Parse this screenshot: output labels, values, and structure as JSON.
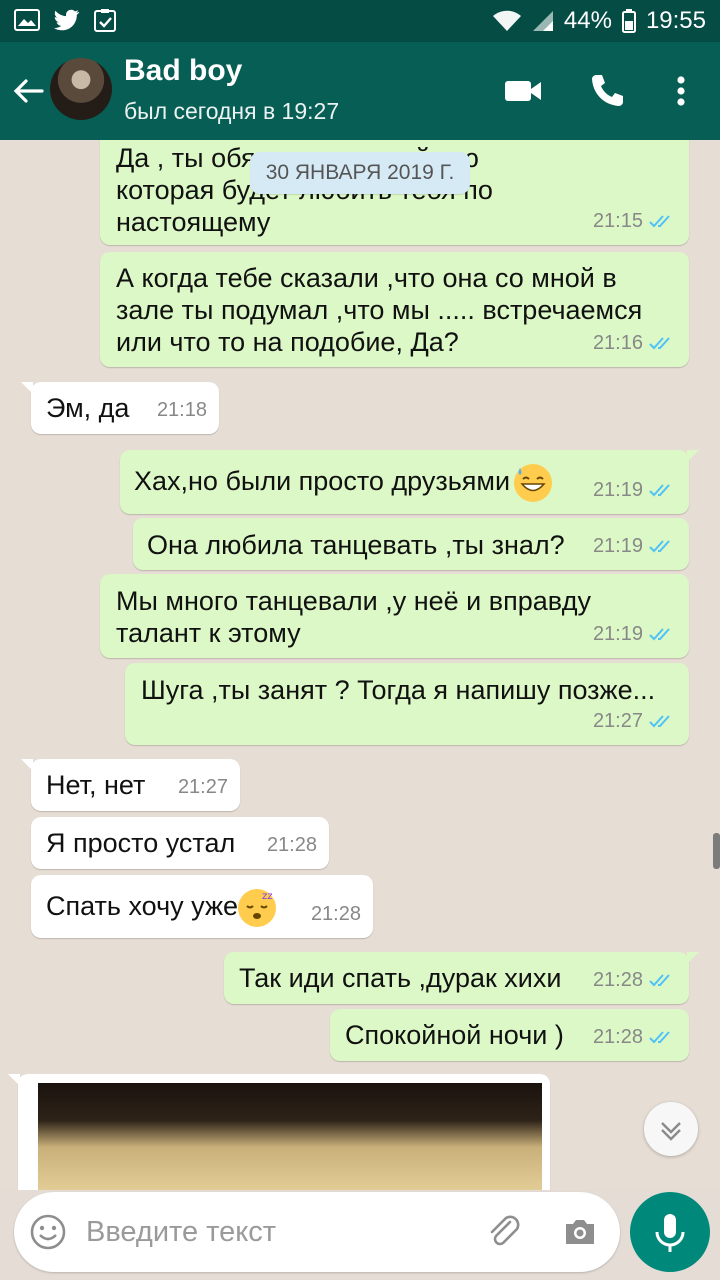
{
  "statusbar": {
    "battery": "44%",
    "time": "19:55"
  },
  "header": {
    "title": "Bad boy",
    "subtitle": "был сегодня в 19:27"
  },
  "date_chip": "30 ЯНВАРЯ 2019 Г.",
  "messages": [
    {
      "text": "Да , ты обя... ешь достойную\nкоторая будет любить тебя по\nнастоящему",
      "time": "21:15"
    },
    {
      "text": "А когда тебе сказали ,что она со мной в\nзале ты подумал ,что мы ..... встречаемся\nили что то на подобие, Да?",
      "time": "21:16"
    },
    {
      "text": "Эм, да",
      "time": "21:18"
    },
    {
      "text": "Хах,но были просто друзьями",
      "time": "21:19"
    },
    {
      "text": "Она любила танцевать ,ты знал?",
      "time": "21:19"
    },
    {
      "text": "Мы много танцевали ,у неё и вправду\nталант к этому",
      "time": "21:19"
    },
    {
      "text": "Шуга ,ты занят ? Тогда я напишу позже...",
      "time": "21:27"
    },
    {
      "text": "Нет, нет",
      "time": "21:27"
    },
    {
      "text": "Я просто устал",
      "time": "21:28"
    },
    {
      "text": "Спать хочу уже",
      "time": "21:28"
    },
    {
      "text": "Так иди спать ,дурак хихи",
      "time": "21:28"
    },
    {
      "text": "Спокойной ночи )",
      "time": "21:28"
    }
  ],
  "input": {
    "placeholder": "Введите текст"
  },
  "colors": {
    "header": "#075e54",
    "statusbar": "#054c44",
    "outgoing": "#dcf8c6",
    "incoming": "#ffffff",
    "tick": "#4fc3f7",
    "mic": "#00897b"
  },
  "icons": [
    "back-arrow-icon",
    "video-call-icon",
    "phone-icon",
    "more-vert-icon",
    "emoji-icon",
    "attach-icon",
    "camera-icon",
    "mic-icon",
    "chevron-down-icon",
    "double-check-icon"
  ]
}
